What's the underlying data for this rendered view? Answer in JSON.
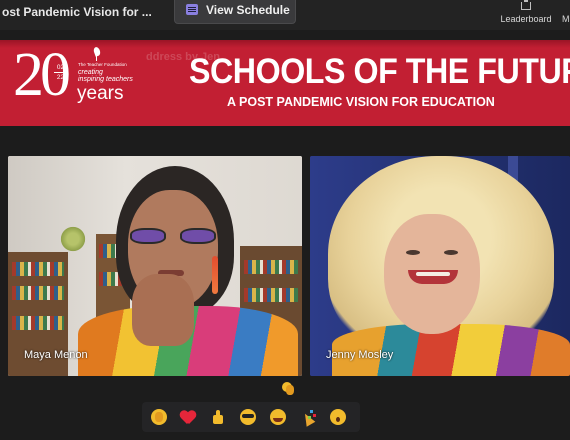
{
  "topbar": {
    "session_title": "ost Pandemic Vision for ...",
    "view_schedule_label": "View Schedule",
    "leaderboard_label": "Leaderboard",
    "more_label": "M"
  },
  "banner": {
    "ticker_text": "ddress by Jen",
    "logo_number": "20",
    "logo_date_top": "02",
    "logo_date_bottom": "22",
    "logo_years": "years",
    "logo_foundation": "The Teacher Foundation",
    "logo_tagline_line1": "creating",
    "logo_tagline_line2": "inspiring teachers",
    "title": "SCHOOLS OF THE FUTURE",
    "subtitle": "A POST PANDEMIC VISION FOR EDUCATION"
  },
  "participants": [
    {
      "name": "Maya Menon"
    },
    {
      "name": "Jenny Mosley"
    }
  ],
  "reaction_bar": [
    "clap",
    "heart",
    "thumbs-up",
    "sunglasses",
    "laughing",
    "party-popper",
    "surprised"
  ],
  "floating_reaction": "clap",
  "colors": {
    "banner_red": "#c21f33",
    "app_background": "#1c1c1c",
    "schedule_icon": "#8a7fe0"
  }
}
